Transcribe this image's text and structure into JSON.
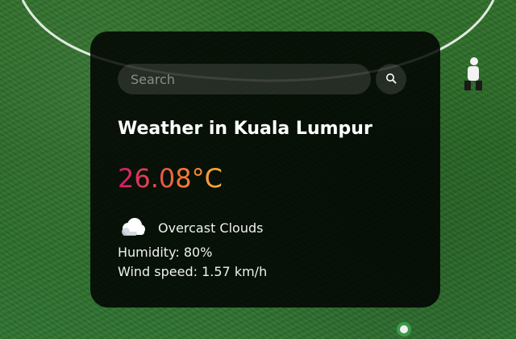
{
  "search": {
    "placeholder": "Search"
  },
  "weather": {
    "title": "Weather in Kuala Lumpur",
    "temperature": "26.08°C",
    "condition": "Overcast Clouds",
    "humidity": "Humidity: 80%",
    "wind": "Wind speed: 1.57 km/h"
  },
  "icons": {
    "search": "search-icon",
    "condition": "cloud-icon"
  },
  "colors": {
    "card_bg": "#000000",
    "temp_gradient_start": "#d4176f",
    "temp_gradient_end": "#ffb23a",
    "text": "#f2f2f2"
  }
}
